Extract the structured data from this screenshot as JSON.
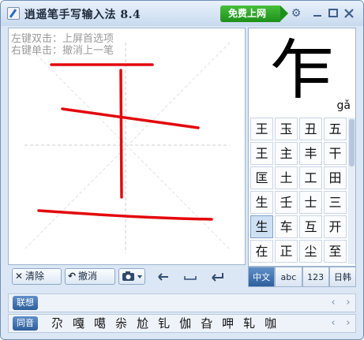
{
  "title": "逍遥笔手写输入法 8.4",
  "online_button": "免费上网",
  "hints": [
    "左键双击：上屏首选项",
    "右键单击：撤消上一笔"
  ],
  "toolbar": {
    "clear": "清除",
    "undo": "撤消"
  },
  "result": {
    "char": "乍",
    "pinyin": "gǎ",
    "candidates": [
      "王",
      "玉",
      "丑",
      "五",
      "王",
      "主",
      "丰",
      "干",
      "匡",
      "土",
      "工",
      "田",
      "生",
      "壬",
      "士",
      "三",
      "生",
      "车",
      "互",
      "开",
      "在",
      "正",
      "尘",
      "至"
    ],
    "selected_index": 16
  },
  "modes": [
    "中文",
    "abc",
    "123",
    "日韩"
  ],
  "association": {
    "label": "联想"
  },
  "homophone": {
    "label": "同音",
    "items": [
      "尕",
      "嘎",
      "噶",
      "尜",
      "尬",
      "钆",
      "伽",
      "旮",
      "呷",
      "轧",
      "咖"
    ]
  },
  "icons": [
    "gear-icon",
    "minimize-icon",
    "maximize-icon",
    "close-icon",
    "camera-icon",
    "left-arrow-icon",
    "space-icon",
    "enter-icon",
    "prev-arrow-icon",
    "next-arrow-icon"
  ]
}
